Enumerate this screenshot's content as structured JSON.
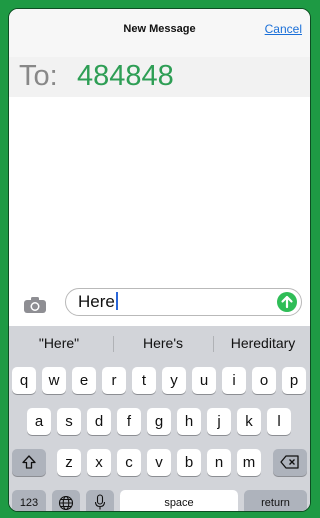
{
  "header": {
    "title": "New Message",
    "cancel_label": "Cancel"
  },
  "to": {
    "label": "To:",
    "value": "484848"
  },
  "compose": {
    "text": "Here"
  },
  "suggestions": [
    "\"Here\"",
    "Here's",
    "Hereditary"
  ],
  "keyboard": {
    "row1": [
      "q",
      "w",
      "e",
      "r",
      "t",
      "y",
      "u",
      "i",
      "o",
      "p"
    ],
    "row2": [
      "a",
      "s",
      "d",
      "f",
      "g",
      "h",
      "j",
      "k",
      "l"
    ],
    "row3": [
      "z",
      "x",
      "c",
      "v",
      "b",
      "n",
      "m"
    ],
    "numbers_label": "123",
    "space_label": "space",
    "return_label": "return"
  },
  "colors": {
    "background": "#1e9a44",
    "recipient": "#2e9e55",
    "send": "#2fbd57",
    "link": "#1a6fd8"
  },
  "icons": {
    "camera": "camera-icon",
    "send": "arrow-up-icon",
    "shift": "shift-icon",
    "delete": "delete-icon",
    "globe": "globe-icon",
    "mic": "microphone-icon"
  }
}
